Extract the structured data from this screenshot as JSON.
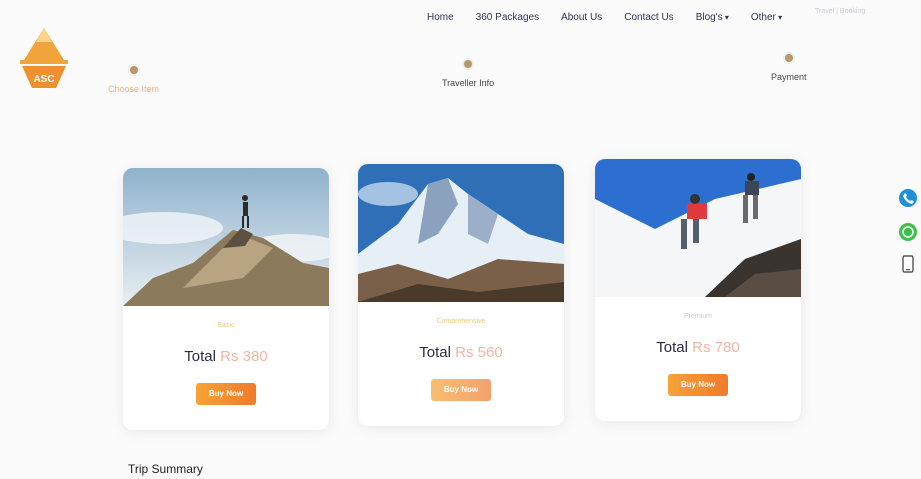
{
  "logo": {
    "text": "ASC"
  },
  "nav": {
    "items": [
      {
        "label": "Home",
        "dropdown": false
      },
      {
        "label": "360 Packages",
        "dropdown": false
      },
      {
        "label": "About Us",
        "dropdown": false
      },
      {
        "label": "Contact Us",
        "dropdown": false
      },
      {
        "label": "Blog's",
        "dropdown": true
      },
      {
        "label": "Other",
        "dropdown": true
      }
    ],
    "extra": "Travel  |  Booking"
  },
  "steps": [
    {
      "label": "Choose Item"
    },
    {
      "label": "Traveller Info"
    },
    {
      "label": "Payment"
    }
  ],
  "cards": [
    {
      "name": "Basic",
      "total_label": "Total",
      "price": "Rs 380",
      "button": "Buy Now"
    },
    {
      "name": "Comprehensive",
      "total_label": "Total",
      "price": "Rs 560",
      "button": "Buy Now"
    },
    {
      "name": "Premium",
      "total_label": "Total",
      "price": "Rs 780",
      "button": "Buy Now"
    }
  ],
  "summary": {
    "title": "Trip Summary"
  },
  "colors": {
    "accent": "#f07a2c",
    "nav_text": "#2a3556",
    "price": "#f1b5a0"
  },
  "icons": [
    "phone-icon",
    "whatsapp-icon",
    "mobile-icon"
  ]
}
